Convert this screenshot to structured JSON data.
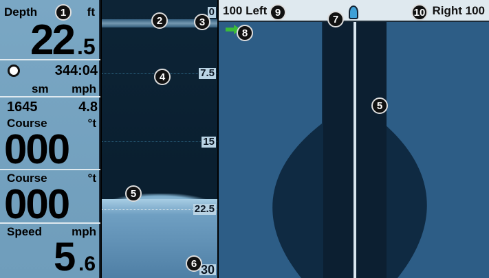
{
  "panel": {
    "depth": {
      "label": "Depth",
      "unit": "ft",
      "value_int": "22",
      "value_dec": ".5"
    },
    "timer": {
      "value": "344:04"
    },
    "units": {
      "left": "sm",
      "right": "mph"
    },
    "trip": {
      "distance": "1645",
      "speed": "4.8"
    },
    "course1": {
      "label": "Course",
      "unit": "°t",
      "value": "000"
    },
    "course2": {
      "label": "Course",
      "unit": "°t",
      "value": "000"
    },
    "speed": {
      "label": "Speed",
      "unit": "mph",
      "value_int": "5",
      "value_dec": ".6"
    }
  },
  "sonar": {
    "scale": [
      "0",
      "7.5",
      "15",
      "22.5",
      "30"
    ]
  },
  "side": {
    "left_label": "100 Left",
    "right_label": "Right 100"
  },
  "callouts": [
    "1",
    "2",
    "3",
    "4",
    "5",
    "6",
    "7",
    "8",
    "9",
    "10"
  ],
  "colors": {
    "panel_bg": "#7aa7c4",
    "sonar_bg": "#0d2436",
    "bottom": "#a7cde4",
    "side_bg": "#2d5d86",
    "boat_icon": "#3fa0d6",
    "arrow_icon": "#3bbb3a"
  }
}
